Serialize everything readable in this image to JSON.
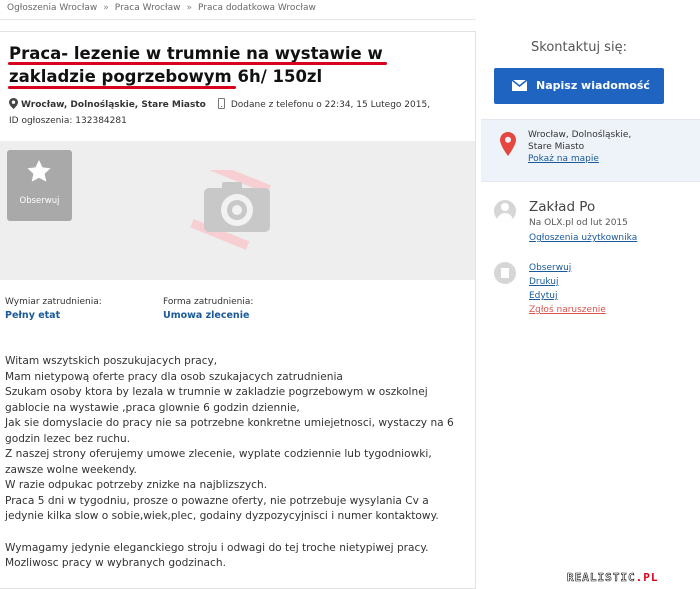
{
  "breadcrumb": [
    "Ogłoszenia Wrocław",
    "Praca Wrocław",
    "Praca dodatkowa Wrocław"
  ],
  "breadcrumb_sep": "»",
  "ad": {
    "title_line1": "Praca- lezenie w trumnie na wystawie w",
    "title_line2": "zakladzie pogrzebowym 6h/ 150zl",
    "location": "Wrocław, Dolnośląskie, Stare Miasto",
    "added": "Dodane z telefonu o 22:34, 15 Lutego 2015,",
    "id_line": "ID ogłoszenia: 132384281",
    "observe_label": "Obserwuj",
    "employment_label": "Wymiar zatrudnienia:",
    "employment_value": "Pełny etat",
    "contract_label": "Forma zatrudnienia:",
    "contract_value": "Umowa zlecenie",
    "description": [
      "Witam wszytskich poszukujacych pracy,",
      "Mam nietypową oferte pracy dla osob szukajacych zatrudnienia",
      "Szukam osoby ktora by lezala w trumnie w zakladzie pogrzebowym w oszkolnej",
      "gablocie na wystawie ,praca glownie 6 godzin dziennie,",
      "Jak sie domyslacie do pracy nie sa potrzebne konkretne umiejetnosci, wystaczy na 6",
      "godzin lezec bez ruchu.",
      "Z naszej strony oferujemy umowe zlecenie, wyplate codziennie lub tygodniowki,",
      "zawsze wolne weekendy.",
      "W razie odpukac potrzeby znizke na najblizszych.",
      "Praca 5 dni w tygodniu, prosze o powazne oferty, nie potrzebuje wysylania Cv a",
      "jedynie kilka slow o sobie,wiek,plec, godainy dyzpozycyjnisci i numer kontaktowy."
    ],
    "description2": [
      "Wymagamy jedynie eleganckiego stroju i odwagi do tej troche nietypiwej pracy.",
      "Mozliwosc pracy w wybranych godzinach."
    ]
  },
  "sidebar": {
    "contact_heading": "Skontaktuj się:",
    "message_button": "Napisz wiadomość",
    "loc_line1": "Wrocław, Dolnośląskie,",
    "loc_line2": "Stare Miasto",
    "map_link": "Pokaż na mapie",
    "user_name": "Zakład Po",
    "user_since": "Na OLX.pl od lut 2015",
    "user_ads": "Ogłoszenia użytkownika",
    "actions": [
      "Obserwuj",
      "Drukuj",
      "Edytuj",
      "Zgłoś naruszenie"
    ]
  },
  "watermark": {
    "main": "REALISTIC",
    "suffix": ".PL"
  },
  "colors": {
    "accent": "#1f64c0",
    "underline": "#d8001c",
    "link": "#1a5a9a"
  }
}
